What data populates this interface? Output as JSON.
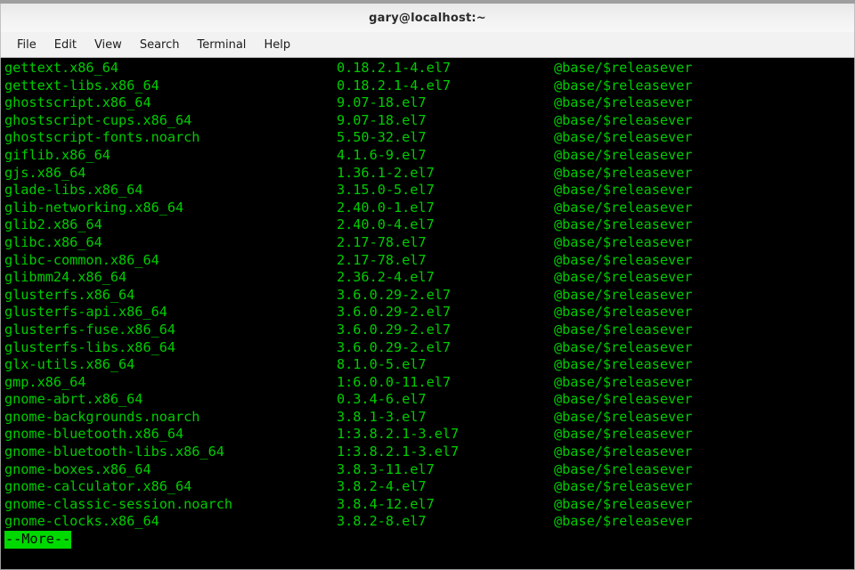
{
  "window": {
    "title": "gary@localhost:~"
  },
  "menubar": {
    "items": [
      {
        "label": "File",
        "name": "menu-file"
      },
      {
        "label": "Edit",
        "name": "menu-edit"
      },
      {
        "label": "View",
        "name": "menu-view"
      },
      {
        "label": "Search",
        "name": "menu-search"
      },
      {
        "label": "Terminal",
        "name": "menu-terminal"
      },
      {
        "label": "Help",
        "name": "menu-help"
      }
    ]
  },
  "terminal": {
    "foreground_color": "#00cc00",
    "background_color": "#000000",
    "highlight_background": "#00d900",
    "highlight_foreground": "#000000",
    "more_prompt": "--More--",
    "rows": [
      {
        "name": "gettext.x86_64",
        "version": "0.18.2.1-4.el7",
        "repo": "@base/$releasever"
      },
      {
        "name": "gettext-libs.x86_64",
        "version": "0.18.2.1-4.el7",
        "repo": "@base/$releasever"
      },
      {
        "name": "ghostscript.x86_64",
        "version": "9.07-18.el7",
        "repo": "@base/$releasever"
      },
      {
        "name": "ghostscript-cups.x86_64",
        "version": "9.07-18.el7",
        "repo": "@base/$releasever"
      },
      {
        "name": "ghostscript-fonts.noarch",
        "version": "5.50-32.el7",
        "repo": "@base/$releasever"
      },
      {
        "name": "giflib.x86_64",
        "version": "4.1.6-9.el7",
        "repo": "@base/$releasever"
      },
      {
        "name": "gjs.x86_64",
        "version": "1.36.1-2.el7",
        "repo": "@base/$releasever"
      },
      {
        "name": "glade-libs.x86_64",
        "version": "3.15.0-5.el7",
        "repo": "@base/$releasever"
      },
      {
        "name": "glib-networking.x86_64",
        "version": "2.40.0-1.el7",
        "repo": "@base/$releasever"
      },
      {
        "name": "glib2.x86_64",
        "version": "2.40.0-4.el7",
        "repo": "@base/$releasever"
      },
      {
        "name": "glibc.x86_64",
        "version": "2.17-78.el7",
        "repo": "@base/$releasever"
      },
      {
        "name": "glibc-common.x86_64",
        "version": "2.17-78.el7",
        "repo": "@base/$releasever"
      },
      {
        "name": "glibmm24.x86_64",
        "version": "2.36.2-4.el7",
        "repo": "@base/$releasever"
      },
      {
        "name": "glusterfs.x86_64",
        "version": "3.6.0.29-2.el7",
        "repo": "@base/$releasever"
      },
      {
        "name": "glusterfs-api.x86_64",
        "version": "3.6.0.29-2.el7",
        "repo": "@base/$releasever"
      },
      {
        "name": "glusterfs-fuse.x86_64",
        "version": "3.6.0.29-2.el7",
        "repo": "@base/$releasever"
      },
      {
        "name": "glusterfs-libs.x86_64",
        "version": "3.6.0.29-2.el7",
        "repo": "@base/$releasever"
      },
      {
        "name": "glx-utils.x86_64",
        "version": "8.1.0-5.el7",
        "repo": "@base/$releasever"
      },
      {
        "name": "gmp.x86_64",
        "version": "1:6.0.0-11.el7",
        "repo": "@base/$releasever"
      },
      {
        "name": "gnome-abrt.x86_64",
        "version": "0.3.4-6.el7",
        "repo": "@base/$releasever"
      },
      {
        "name": "gnome-backgrounds.noarch",
        "version": "3.8.1-3.el7",
        "repo": "@base/$releasever"
      },
      {
        "name": "gnome-bluetooth.x86_64",
        "version": "1:3.8.2.1-3.el7",
        "repo": "@base/$releasever"
      },
      {
        "name": "gnome-bluetooth-libs.x86_64",
        "version": "1:3.8.2.1-3.el7",
        "repo": "@base/$releasever"
      },
      {
        "name": "gnome-boxes.x86_64",
        "version": "3.8.3-11.el7",
        "repo": "@base/$releasever"
      },
      {
        "name": "gnome-calculator.x86_64",
        "version": "3.8.2-4.el7",
        "repo": "@base/$releasever"
      },
      {
        "name": "gnome-classic-session.noarch",
        "version": "3.8.4-12.el7",
        "repo": "@base/$releasever"
      },
      {
        "name": "gnome-clocks.x86_64",
        "version": "3.8.2-8.el7",
        "repo": "@base/$releasever"
      }
    ]
  }
}
